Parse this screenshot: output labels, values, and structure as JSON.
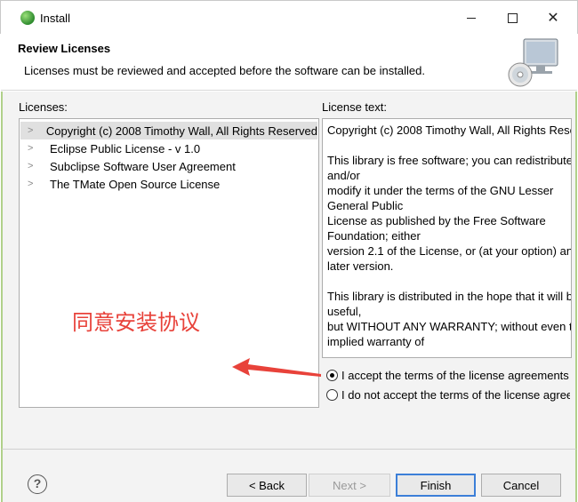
{
  "window": {
    "title": "Install"
  },
  "header": {
    "title": "Review Licenses",
    "description": "Licenses must be reviewed and accepted before the software can be installed."
  },
  "licenses": {
    "label": "Licenses:",
    "items": [
      "Copyright (c) 2008 Timothy Wall, All Rights Reserved",
      "Eclipse Public License - v 1.0",
      "Subclipse Software User Agreement",
      "The TMate Open Source License"
    ],
    "selected_index": 0
  },
  "license_text": {
    "label": "License text:",
    "content": "Copyright (c) 2008 Timothy Wall, All Rights Reserved\n\nThis library is free software; you can redistribute it\nand/or\nmodify it under the terms of the GNU Lesser\nGeneral Public\nLicense as published by the Free Software\nFoundation; either\nversion 2.1 of the License, or (at your option) any\nlater version.\n\nThis library is distributed in the hope that it will be\nuseful,\nbut WITHOUT ANY WARRANTY; without even the\nimplied warranty of"
  },
  "options": {
    "accept": "I accept the terms of the license agreements",
    "decline": "I do not accept the terms of the license agreements",
    "selected": "accept"
  },
  "annotation": {
    "text": "同意安装协议",
    "color": "#e8423a"
  },
  "buttons": {
    "help": "?",
    "back": "< Back",
    "next": "Next >",
    "finish": "Finish",
    "cancel": "Cancel"
  }
}
